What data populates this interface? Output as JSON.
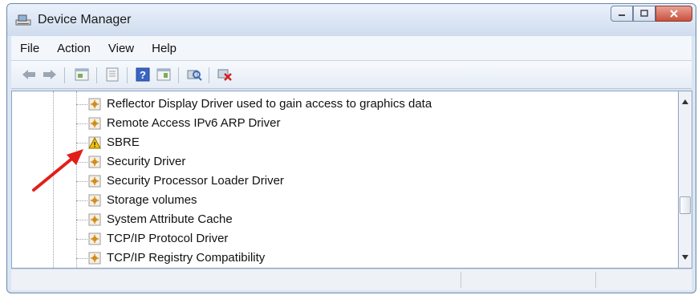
{
  "window": {
    "title": "Device Manager"
  },
  "menu": [
    "File",
    "Action",
    "View",
    "Help"
  ],
  "toolbar": [
    "back-icon",
    "forward-icon",
    "properties-icon",
    "show-hide-console-tree-icon",
    "help-icon",
    "show-action-pane-icon",
    "scan-hardware-changes-icon",
    "uninstall-device-icon"
  ],
  "devices": [
    {
      "label": "Reflector Display Driver used to gain access to graphics data",
      "icon": "device-icon",
      "warning": false
    },
    {
      "label": "Remote Access IPv6 ARP Driver",
      "icon": "device-icon",
      "warning": false
    },
    {
      "label": "SBRE",
      "icon": "warning-device-icon",
      "warning": true
    },
    {
      "label": "Security Driver",
      "icon": "device-icon",
      "warning": false
    },
    {
      "label": "Security Processor Loader Driver",
      "icon": "device-icon",
      "warning": false
    },
    {
      "label": "Storage volumes",
      "icon": "device-icon",
      "warning": false
    },
    {
      "label": "System Attribute Cache",
      "icon": "device-icon",
      "warning": false
    },
    {
      "label": "TCP/IP Protocol Driver",
      "icon": "device-icon",
      "warning": false
    },
    {
      "label": "TCP/IP Registry Compatibility",
      "icon": "device-icon",
      "warning": false
    }
  ],
  "colors": {
    "annotation_arrow": "#e0201b",
    "warning": "#f2c200"
  }
}
